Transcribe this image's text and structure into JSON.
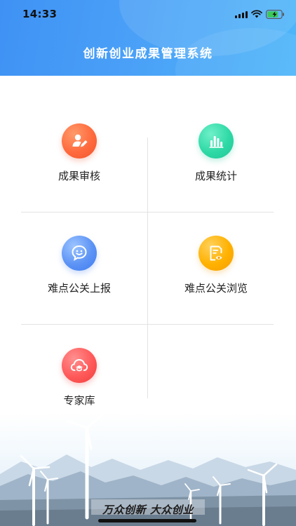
{
  "status_bar": {
    "time": "14:33"
  },
  "header": {
    "title": "创新创业成果管理系统",
    "gradient_start": "#3f92f4",
    "gradient_end": "#4fb6f9"
  },
  "menu": {
    "items": [
      {
        "label": "成果审核",
        "icon": "reviewer-pen-icon",
        "color": "#f0542c"
      },
      {
        "label": "成果统计",
        "icon": "bar-chart-icon",
        "color": "#1fc796"
      },
      {
        "label": "难点公关上报",
        "icon": "chat-bubble-icon",
        "color": "#3f7cf0"
      },
      {
        "label": "难点公关浏览",
        "icon": "document-eye-icon",
        "color": "#f59d00"
      },
      {
        "label": "专家库",
        "icon": "cloud-graduation-cap-icon",
        "color": "#f03d3d"
      }
    ]
  },
  "footer": {
    "slogan": "万众创新 大众创业"
  }
}
